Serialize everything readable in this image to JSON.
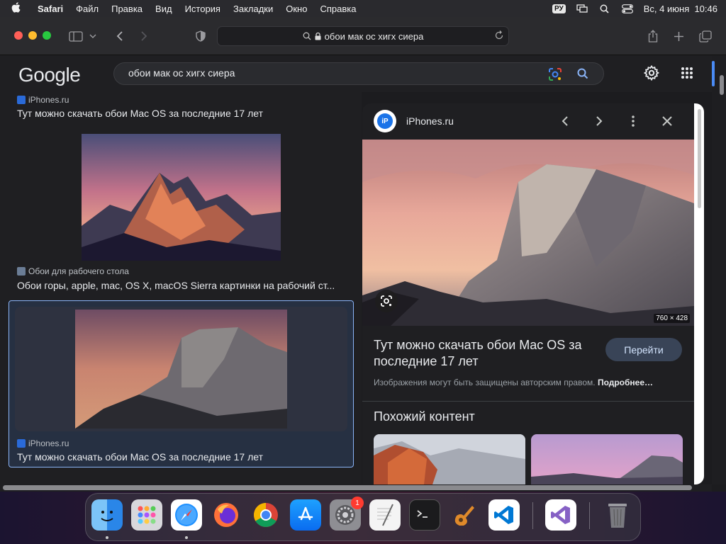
{
  "menubar": {
    "apple_icon": "apple-logo",
    "app": "Safari",
    "items": [
      "Файл",
      "Правка",
      "Вид",
      "История",
      "Закладки",
      "Окно",
      "Справка"
    ],
    "input_source": "РУ",
    "datetime": "Вс, 4 июня  10:46"
  },
  "toolbar": {
    "address": "обои мак ос хигх сиера"
  },
  "google": {
    "logo": "Google",
    "query": "обои мак ос хигх сиера"
  },
  "results": [
    {
      "source": "iPhones.ru",
      "title": "Тут можно скачать обои Mac OS за последние 17 лет"
    },
    {
      "source": "Обои для рабочего стола",
      "title": "Обои горы, apple, mac, OS X, macOS Sierra картинки на рабочий ст..."
    },
    {
      "source": "iPhones.ru",
      "title": "Тут можно скачать обои Mac OS за последние 17 лет"
    }
  ],
  "panel": {
    "site": "iPhones.ru",
    "logo_text": "iP",
    "dimensions": "760 × 428",
    "title": "Тут можно скачать обои Mac OS за последние 17 лет",
    "go_button": "Перейти",
    "copyright": "Изображения могут быть защищены авторским правом.",
    "more_link": "Подробнее…",
    "related_heading": "Похожий контент"
  },
  "dock": {
    "apps": [
      "Finder",
      "Launchpad",
      "Safari",
      "Firefox",
      "Chrome",
      "App Store",
      "System Settings",
      "TextEdit",
      "Terminal",
      "GarageBand",
      "Visual Studio Code",
      "Visual Studio",
      "Trash"
    ],
    "settings_badge": "1"
  },
  "colors": {
    "accent": "#8ab4f8",
    "background": "#1f1f22",
    "selected_card": "#263042"
  }
}
